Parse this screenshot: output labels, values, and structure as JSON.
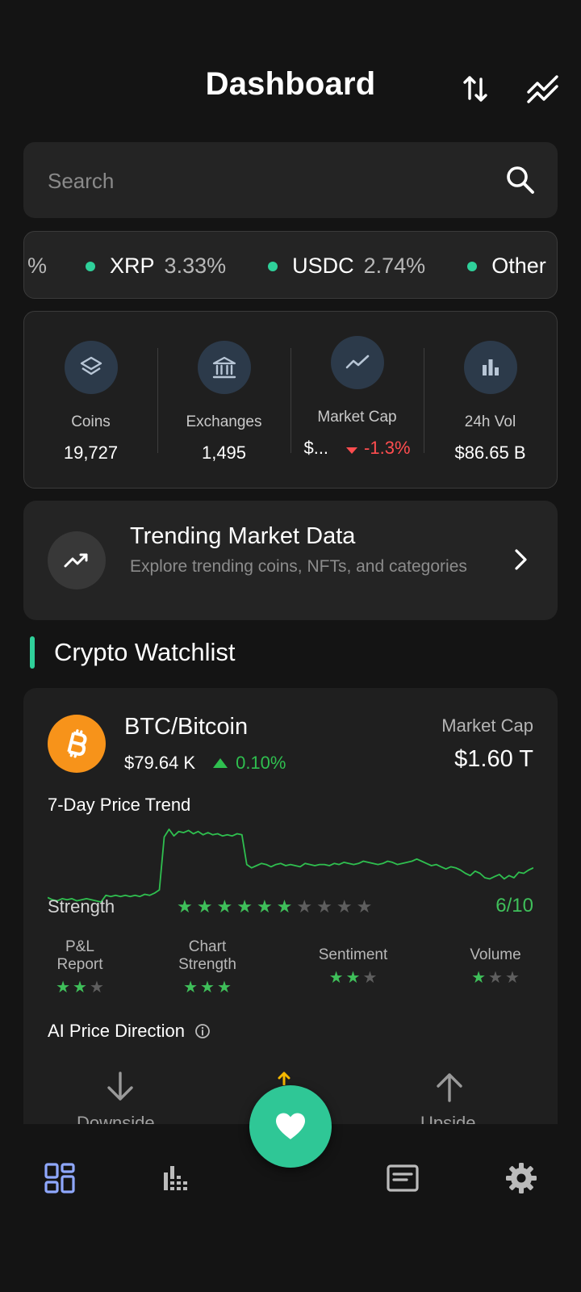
{
  "header": {
    "title": "Dashboard",
    "sort_icon": "sort-arrows-icon",
    "trend_icon": "market-trend-icon"
  },
  "search": {
    "placeholder": "Search",
    "icon": "search-icon"
  },
  "ticker": {
    "lead": "%",
    "items": [
      {
        "name": "XRP",
        "value": "3.33%"
      },
      {
        "name": "USDC",
        "value": "2.74%"
      },
      {
        "name": "Other",
        "value": ""
      }
    ],
    "dot_color": "#2fd09a"
  },
  "stats": [
    {
      "label": "Coins",
      "value": "19,727",
      "icon": "layers-icon"
    },
    {
      "label": "Exchanges",
      "value": "1,495",
      "icon": "bank-icon"
    },
    {
      "label": "Market Cap",
      "value": "$...",
      "change": "-1.3%",
      "icon": "line-chart-icon"
    },
    {
      "label": "24h Vol",
      "value": "$86.65 B",
      "icon": "bar-chart-icon"
    }
  ],
  "trending": {
    "title": "Trending Market Data",
    "subtitle": "Explore trending coins, NFTs, and categories"
  },
  "watchlist": {
    "title": "Crypto Watchlist",
    "accent": "#2fd09a",
    "coin": {
      "name": "BTC/Bitcoin",
      "price": "$79.64 K",
      "change": "0.10%",
      "market_cap_label": "Market Cap",
      "market_cap": "$1.60 T",
      "trend_label": "7-Day Price Trend",
      "strength_label": "Strength",
      "strength": 6,
      "strength_max": 10,
      "strength_text": "6/10",
      "metrics": [
        {
          "label_lines": [
            "P&L",
            "Report"
          ],
          "stars": 2,
          "max": 3
        },
        {
          "label_lines": [
            "Chart",
            "Strength"
          ],
          "stars": 3,
          "max": 3
        },
        {
          "label_lines": [
            "Sentiment"
          ],
          "stars": 2,
          "max": 3
        },
        {
          "label_lines": [
            "Volume"
          ],
          "stars": 1,
          "max": 3
        }
      ],
      "ai_label": "AI Price Direction",
      "directions": [
        "Downside",
        "Upside"
      ]
    }
  },
  "chart_data": {
    "type": "line",
    "series": [
      {
        "values": [
          1.0,
          0.98,
          0.97,
          0.99,
          0.98,
          0.99,
          0.97,
          0.98,
          0.99,
          0.98,
          0.97,
          0.96,
          1.02,
          1.01,
          1.02,
          1.01,
          1.02,
          1.01,
          1.02,
          1.01,
          1.03,
          1.02,
          1.04,
          1.07,
          1.55,
          1.62,
          1.56,
          1.6,
          1.59,
          1.61,
          1.58,
          1.6,
          1.57,
          1.59,
          1.57,
          1.58,
          1.56,
          1.57,
          1.56,
          1.58,
          1.57,
          1.3,
          1.27,
          1.29,
          1.31,
          1.3,
          1.28,
          1.3,
          1.31,
          1.29,
          1.3,
          1.29,
          1.28,
          1.31,
          1.3,
          1.29,
          1.3,
          1.3,
          1.29,
          1.31,
          1.3,
          1.32,
          1.31,
          1.3,
          1.31,
          1.33,
          1.32,
          1.31,
          1.3,
          1.31,
          1.33,
          1.32,
          1.3,
          1.31,
          1.32,
          1.33,
          1.35,
          1.33,
          1.31,
          1.29,
          1.3,
          1.28,
          1.26,
          1.28,
          1.27,
          1.25,
          1.22,
          1.2,
          1.24,
          1.22,
          1.18,
          1.17,
          1.19,
          1.21,
          1.17,
          1.2,
          1.18,
          1.23,
          1.22,
          1.25,
          1.27
        ]
      }
    ],
    "color": "#2fbf4f"
  },
  "nav": {
    "items": [
      "dashboard-icon",
      "markets-icon",
      "news-icon",
      "settings-icon"
    ],
    "fab": "favorite-heart-icon"
  }
}
